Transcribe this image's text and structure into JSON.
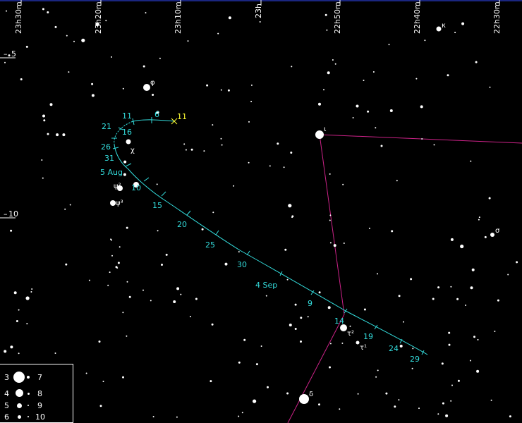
{
  "ra_labels": [
    "23h30m",
    "23h20m",
    "23h10m",
    "23h",
    "22h50m",
    "22h40m",
    "22h30m"
  ],
  "dec_labels": [
    "5",
    "10"
  ],
  "path_dates": [
    "11",
    "6",
    "11",
    "21",
    "16",
    "26",
    "31",
    "5 Aug",
    "10",
    "15",
    "20",
    "25",
    "30",
    "4 Sep",
    "9",
    "14",
    "19",
    "24",
    "29"
  ],
  "star_labels": {
    "kappa": "κ",
    "phi": "φ",
    "chi": "χ",
    "iota": "ι",
    "psi2": "ψ²",
    "psi3": "ψ³",
    "sigma": "σ",
    "tau2": "τ²",
    "tau1": "τ¹",
    "delta": "δ"
  },
  "legend": {
    "left_mags": [
      "3",
      "4",
      "5",
      "6"
    ],
    "right_mags": [
      "7",
      "8",
      "9",
      "10"
    ]
  },
  "colors": {
    "background": "#000000",
    "path": "#33dddd",
    "current_marker": "#ffff33",
    "constellation_lines": "#cc2288",
    "ra_line": "#2233aa",
    "stars": "#ffffff"
  }
}
